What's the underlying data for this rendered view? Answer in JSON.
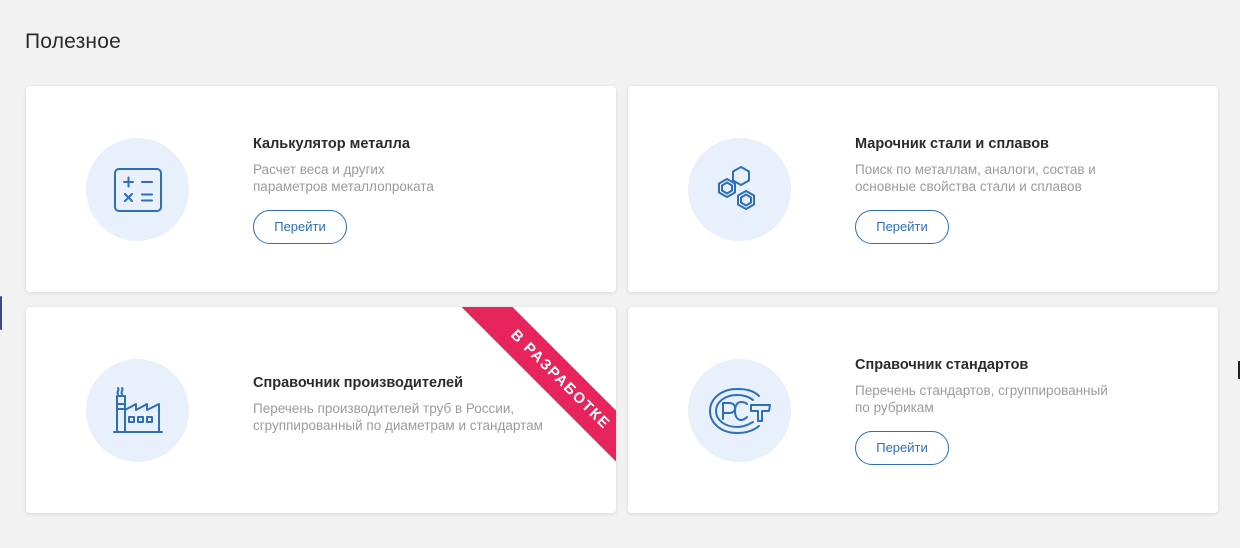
{
  "section": {
    "title": "Полезное"
  },
  "cards": [
    {
      "icon": "calculator-icon",
      "title": "Калькулятор металла",
      "description": "Расчет веса и других\nпараметров металлопроката",
      "button_label": "Перейти"
    },
    {
      "icon": "hexagons-icon",
      "title": "Марочник стали и сплавов",
      "description": "Поиск по металлам, аналоги, состав и\nосновные свойства стали и сплавов",
      "button_label": "Перейти"
    },
    {
      "icon": "factory-icon",
      "title": "Справочник производителей",
      "description": "Перечень производителей труб в России,\nсгруппированный по диаметрам и стандартам",
      "ribbon_label": "В РАЗРАБОТКЕ"
    },
    {
      "icon": "gost-rst-icon",
      "title": "Справочник стандартов",
      "description": "Перечень стандартов, сгруппированный\nпо рубрикам",
      "button_label": "Перейти"
    }
  ],
  "colors": {
    "background": "#f2f2f3",
    "card": "#ffffff",
    "icon_circle": "#e7f0fb",
    "icon_stroke": "#2e6fb8",
    "accent": "#2e6fb8",
    "ribbon": "#e8245c",
    "title_text": "#2b2b2b",
    "muted_text": "#9b9b9b"
  }
}
